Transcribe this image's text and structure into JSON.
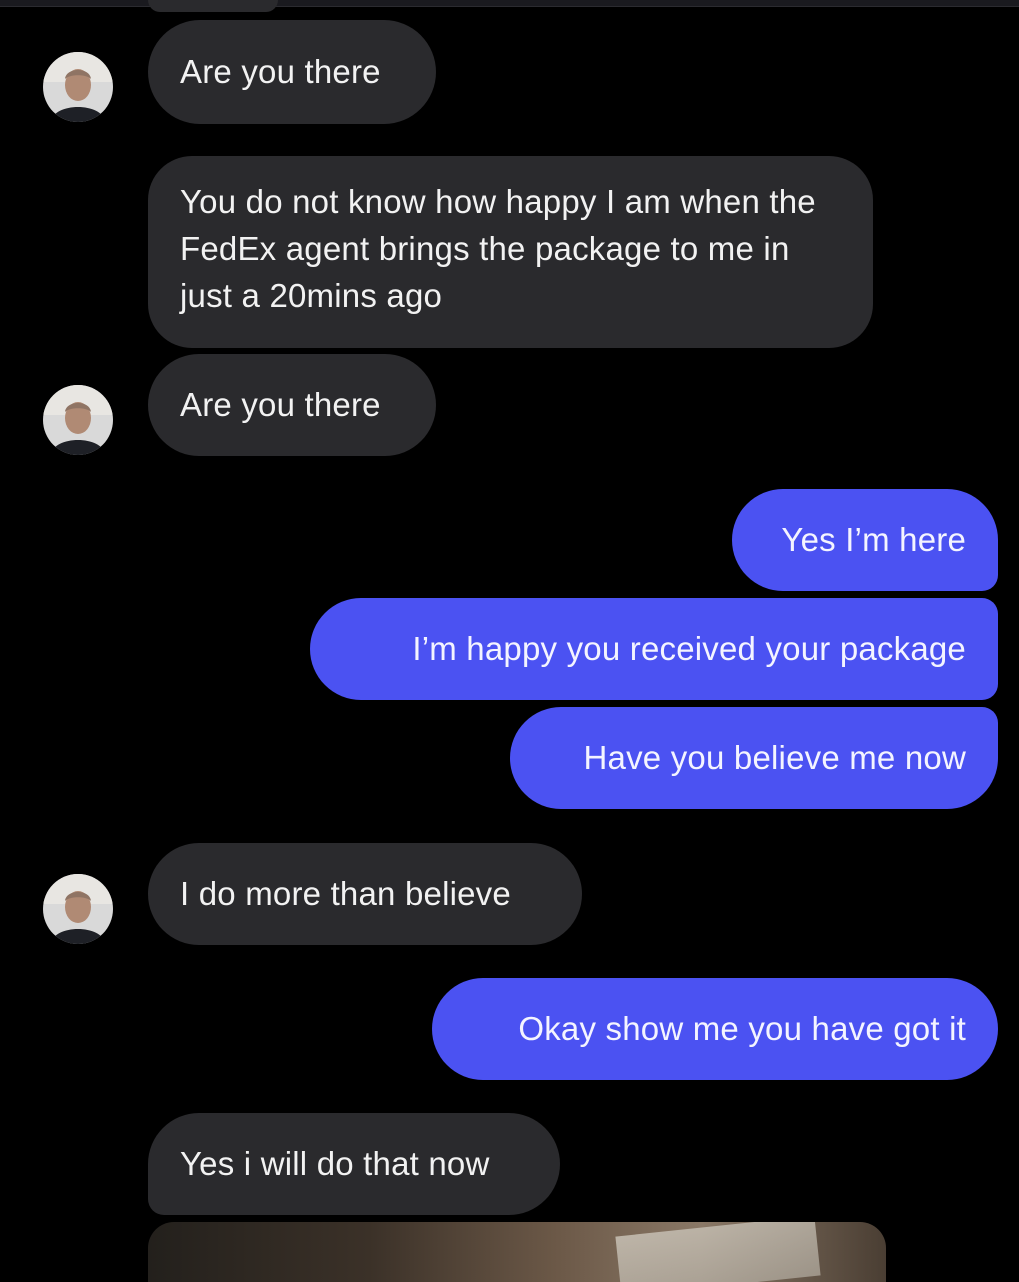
{
  "conversation": {
    "messages": [
      {
        "sender": "them",
        "text": "Are you there",
        "avatar": true
      },
      {
        "sender": "them",
        "text": "You do not know how happy I am when the FedEx agent brings the package to me in just a 20mins ago",
        "avatar": false
      },
      {
        "sender": "them",
        "text": "Are you there",
        "avatar": true
      },
      {
        "sender": "me",
        "text": "Yes I’m here"
      },
      {
        "sender": "me",
        "text": "I’m happy you received your package"
      },
      {
        "sender": "me",
        "text": "Have you believe me now"
      },
      {
        "sender": "them",
        "text": "I do more than believe",
        "avatar": true
      },
      {
        "sender": "me",
        "text": "Okay show me you have got it"
      },
      {
        "sender": "them",
        "text": "Yes i will do that now",
        "avatar": false
      }
    ]
  },
  "colors": {
    "background": "#000000",
    "incoming_bubble": "#2a2a2d",
    "outgoing_bubble": "#4b52f2",
    "text": "#f2f2f2"
  },
  "icons": {
    "avatar": "contact-photo-avatar"
  }
}
